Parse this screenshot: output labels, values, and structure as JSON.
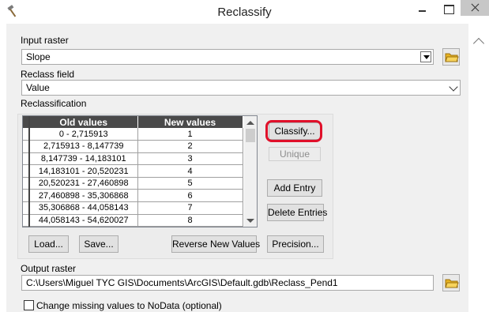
{
  "window": {
    "title": "Reclassify",
    "icon": "hammer-icon"
  },
  "input_raster": {
    "label": "Input raster",
    "value": "Slope"
  },
  "reclass_field": {
    "label": "Reclass field",
    "value": "Value"
  },
  "reclassification": {
    "label": "Reclassification",
    "columns": [
      "Old values",
      "New values"
    ],
    "rows": [
      {
        "old": "0 - 2,715913",
        "new": "1"
      },
      {
        "old": "2,715913 - 8,147739",
        "new": "2"
      },
      {
        "old": "8,147739 - 14,183101",
        "new": "3"
      },
      {
        "old": "14,183101 - 20,520231",
        "new": "4"
      },
      {
        "old": "20,520231 - 27,460898",
        "new": "5"
      },
      {
        "old": "27,460898 - 35,306868",
        "new": "6"
      },
      {
        "old": "35,306868 - 44,058143",
        "new": "7"
      },
      {
        "old": "44,058143 - 54,620027",
        "new": "8"
      }
    ],
    "buttons": {
      "classify": "Classify...",
      "unique": "Unique",
      "add_entry": "Add Entry",
      "delete_entries": "Delete Entries",
      "load": "Load...",
      "save": "Save...",
      "reverse": "Reverse New Values",
      "precision": "Precision..."
    }
  },
  "output_raster": {
    "label": "Output raster",
    "value": "C:\\Users\\Miguel TYC GIS\\Documents\\ArcGIS\\Default.gdb\\Reclass_Pend1"
  },
  "nodata_option": {
    "label": "Change missing values to NoData (optional)",
    "checked": false
  },
  "colors": {
    "highlight": "#e0102a",
    "grid_header": "#4a4a4a",
    "folder": "#e8b321"
  }
}
